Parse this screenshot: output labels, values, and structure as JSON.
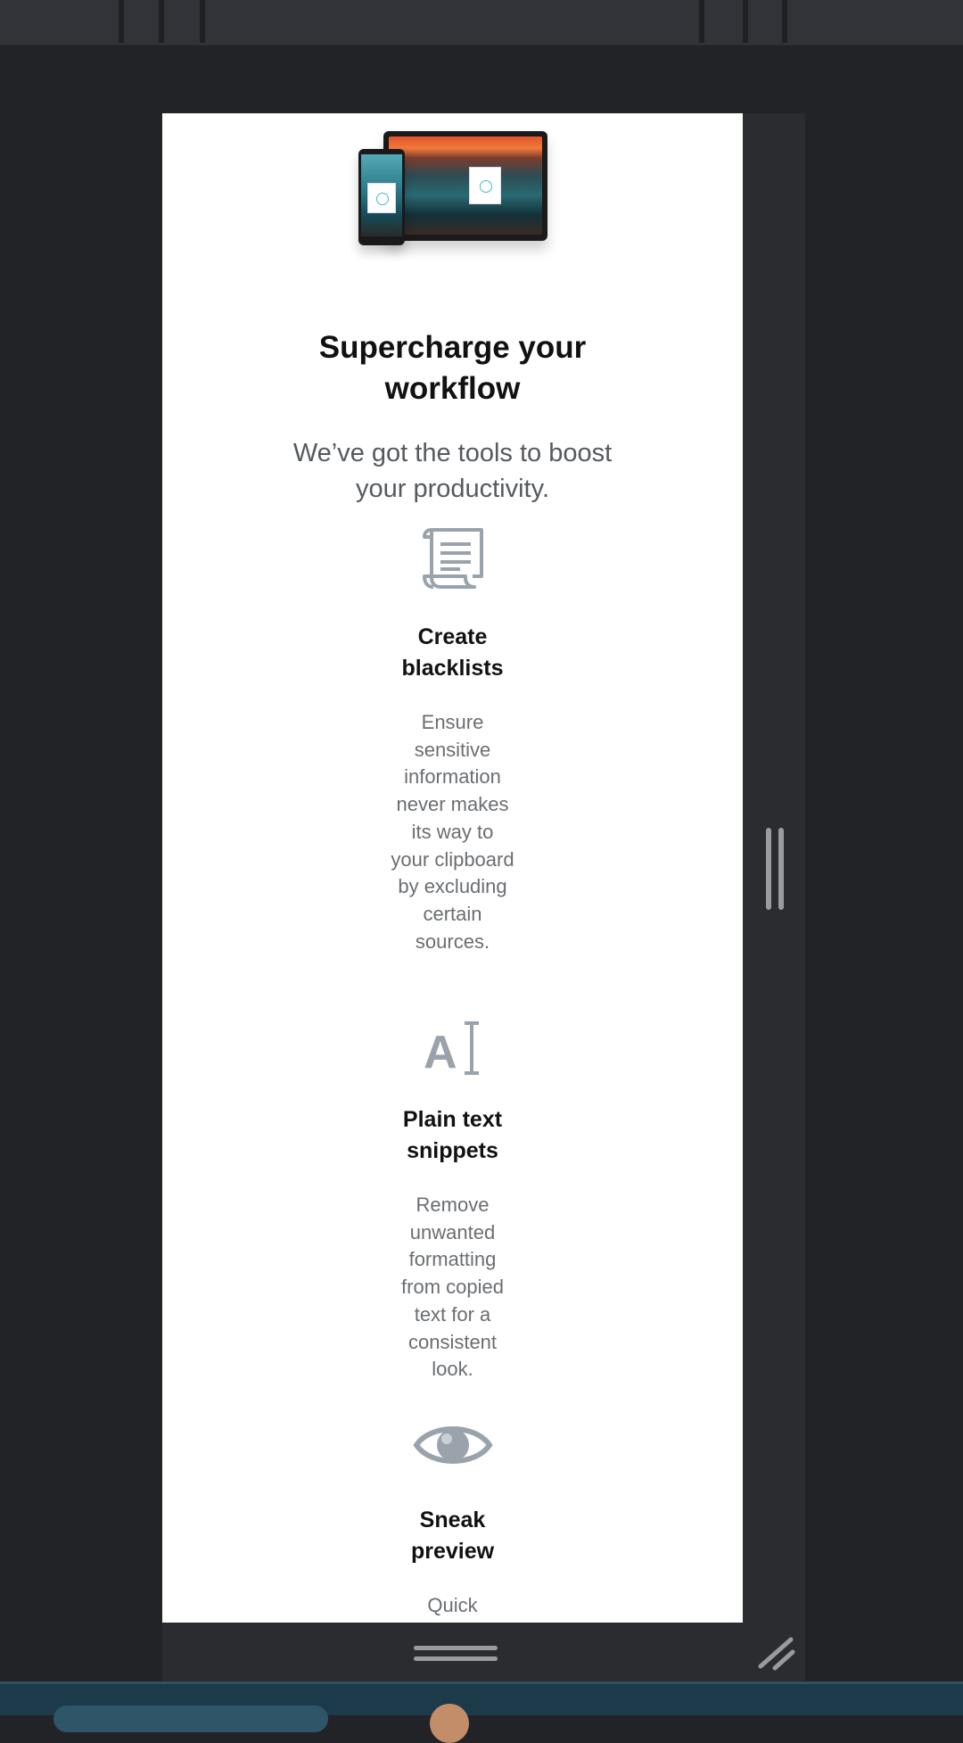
{
  "headline": "Supercharge your workflow",
  "subhead": "We’ve got the tools to boost your productivity.",
  "features": [
    {
      "icon": "scroll-document-icon",
      "title": "Create blacklists",
      "description": "Ensure sensitive information never makes its way to your clipboard by excluding certain sources."
    },
    {
      "icon": "text-cursor-icon",
      "title": "Plain text snippets",
      "description": "Remove unwanted formatting from copied text for a consistent look."
    },
    {
      "icon": "eye-icon",
      "title": "Sneak preview",
      "description": "Quick"
    }
  ],
  "colors": {
    "page_bg": "#ffffff",
    "window_bg": "#222326",
    "icon_gray": "#9aa3ab",
    "headline": "#111111",
    "body_text": "#6a6e72"
  }
}
